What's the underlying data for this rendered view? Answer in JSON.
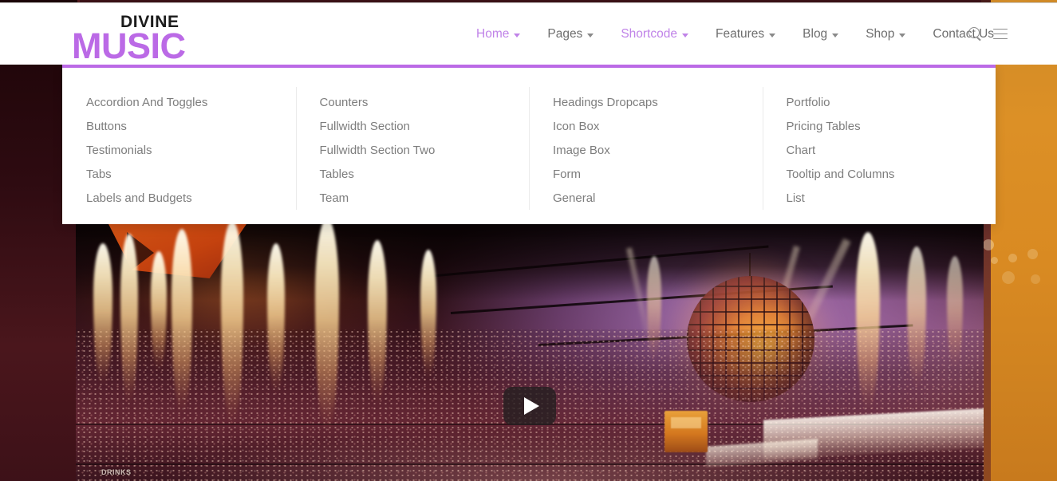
{
  "site": {
    "logo": {
      "top_word": "DIVINE",
      "main_word": "MUSIC",
      "accent_color": "#bb6ae6"
    }
  },
  "header": {
    "nav": [
      {
        "label": "Home",
        "has_caret": true,
        "active": true
      },
      {
        "label": "Pages",
        "has_caret": true,
        "active": false
      },
      {
        "label": "Shortcode",
        "has_caret": true,
        "active": true
      },
      {
        "label": "Features",
        "has_caret": true,
        "active": false
      },
      {
        "label": "Blog",
        "has_caret": true,
        "active": false
      },
      {
        "label": "Shop",
        "has_caret": true,
        "active": false
      },
      {
        "label": "Contact Us",
        "has_caret": false,
        "active": false
      }
    ],
    "tools": [
      {
        "icon": "search-icon"
      },
      {
        "icon": "hamburger-menu-icon"
      }
    ]
  },
  "mega_menu": {
    "open_for": "Shortcode",
    "accent_color": "#bb6ae6",
    "columns": [
      {
        "items": [
          "Accordion And Toggles",
          "Buttons",
          "Testimonials",
          "Tabs",
          "Labels and Budgets"
        ]
      },
      {
        "items": [
          "Counters",
          "Fullwidth Section",
          "Fullwidth Section Two",
          "Tables",
          "Team"
        ]
      },
      {
        "items": [
          "Headings Dropcaps",
          "Icon Box",
          "Image Box",
          "Form",
          "General"
        ]
      },
      {
        "items": [
          "Portfolio",
          "Pricing Tables",
          "Chart",
          "Tooltip and Columns",
          "List"
        ]
      }
    ]
  },
  "hero": {
    "media_type": "video",
    "play_button_label": "Play",
    "scene_caption": "DRINKS"
  }
}
